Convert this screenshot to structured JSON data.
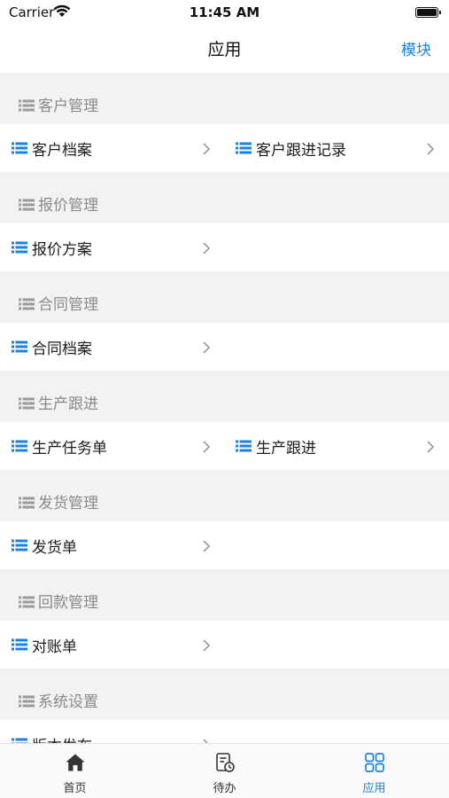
{
  "status_bar": {
    "carrier": "Carrier",
    "time": "11:45 AM"
  },
  "nav": {
    "title": "应用",
    "right_label": "模块"
  },
  "colors": {
    "accent": "#1a82e0",
    "section_text": "#8a8a8a",
    "section_bg": "#f2f2f2"
  },
  "sections": [
    {
      "title": "客户管理",
      "items": [
        "客户档案",
        "客户跟进记录"
      ]
    },
    {
      "title": "报价管理",
      "items": [
        "报价方案"
      ]
    },
    {
      "title": "合同管理",
      "items": [
        "合同档案"
      ]
    },
    {
      "title": "生产跟进",
      "items": [
        "生产任务单",
        "生产跟进"
      ]
    },
    {
      "title": "发货管理",
      "items": [
        "发货单"
      ]
    },
    {
      "title": "回款管理",
      "items": [
        "对账单"
      ]
    },
    {
      "title": "系统设置",
      "items": [
        "版本发布"
      ]
    }
  ],
  "tabs": [
    {
      "label": "首页",
      "icon": "home-icon"
    },
    {
      "label": "待办",
      "icon": "todo-icon"
    },
    {
      "label": "应用",
      "icon": "apps-icon",
      "active": true
    }
  ]
}
